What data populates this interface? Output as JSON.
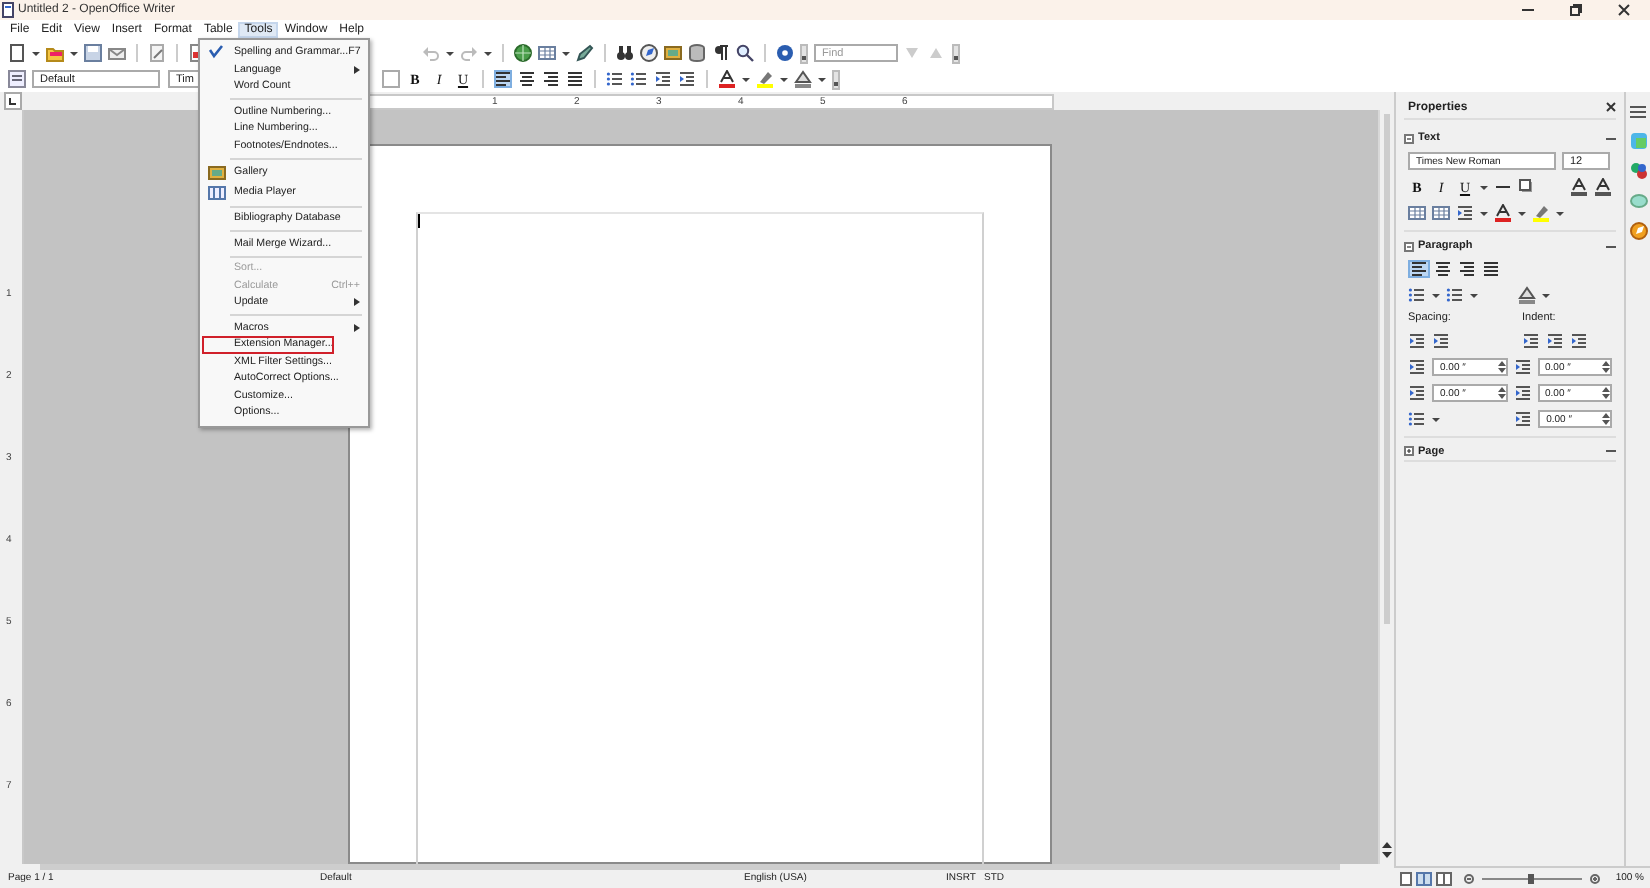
{
  "window": {
    "title": "Untitled 2 - OpenOffice Writer"
  },
  "menu_bar": [
    {
      "label": "File",
      "selected": false
    },
    {
      "label": "Edit",
      "selected": false
    },
    {
      "label": "View",
      "selected": false
    },
    {
      "label": "Insert",
      "selected": false
    },
    {
      "label": "Format",
      "selected": false
    },
    {
      "label": "Table",
      "selected": false
    },
    {
      "label": "Tools",
      "selected": true
    },
    {
      "label": "Window",
      "selected": false
    },
    {
      "label": "Help",
      "selected": false
    }
  ],
  "standard_toolbar": {
    "find_placeholder": "Find"
  },
  "formatting_toolbar": {
    "paragraph_style": "Default",
    "font_name": "Tim",
    "format_buttons": [
      "B",
      "I",
      "U"
    ],
    "alignment": [
      {
        "selected": true
      },
      {
        "selected": false
      },
      {
        "selected": false
      },
      {
        "selected": false
      }
    ]
  },
  "horizontal_ruler": [
    "1",
    "2",
    "3",
    "4",
    "5",
    "6"
  ],
  "vertical_ruler": [
    "1",
    "2",
    "3",
    "4",
    "5",
    "6",
    "7"
  ],
  "tools_menu": [
    {
      "kind": "item",
      "label": "Spelling and Grammar...",
      "shortcut": "F7",
      "has_icon": true,
      "submenu": false,
      "disabled": false,
      "outlined": false
    },
    {
      "kind": "item",
      "label": "Language",
      "has_icon": false,
      "submenu": true,
      "disabled": false,
      "outlined": false
    },
    {
      "kind": "item",
      "label": "Word Count",
      "has_icon": false,
      "submenu": false,
      "disabled": false,
      "outlined": false
    },
    {
      "kind": "separator"
    },
    {
      "kind": "item",
      "label": "Outline Numbering...",
      "has_icon": false,
      "submenu": false,
      "disabled": false,
      "outlined": false
    },
    {
      "kind": "item",
      "label": "Line Numbering...",
      "has_icon": false,
      "submenu": false,
      "disabled": false,
      "outlined": false
    },
    {
      "kind": "item",
      "label": "Footnotes/Endnotes...",
      "has_icon": false,
      "submenu": false,
      "disabled": false,
      "outlined": false
    },
    {
      "kind": "separator"
    },
    {
      "kind": "item",
      "label": "Gallery",
      "has_icon": true,
      "submenu": false,
      "disabled": false,
      "outlined": false
    },
    {
      "kind": "item",
      "label": "Media Player",
      "has_icon": true,
      "submenu": false,
      "disabled": false,
      "outlined": false
    },
    {
      "kind": "separator"
    },
    {
      "kind": "item",
      "label": "Bibliography Database",
      "has_icon": false,
      "submenu": false,
      "disabled": false,
      "outlined": false
    },
    {
      "kind": "separator"
    },
    {
      "kind": "item",
      "label": "Mail Merge Wizard...",
      "has_icon": false,
      "submenu": false,
      "disabled": false,
      "outlined": false
    },
    {
      "kind": "separator"
    },
    {
      "kind": "item",
      "label": "Sort...",
      "has_icon": false,
      "submenu": false,
      "disabled": true,
      "outlined": false
    },
    {
      "kind": "item",
      "label": "Calculate",
      "shortcut": "Ctrl++",
      "has_icon": false,
      "submenu": false,
      "disabled": true,
      "outlined": false
    },
    {
      "kind": "item",
      "label": "Update",
      "has_icon": false,
      "submenu": true,
      "disabled": false,
      "outlined": false
    },
    {
      "kind": "separator"
    },
    {
      "kind": "item",
      "label": "Macros",
      "has_icon": false,
      "submenu": true,
      "disabled": false,
      "outlined": false
    },
    {
      "kind": "item",
      "label": "Extension Manager...",
      "has_icon": false,
      "submenu": false,
      "disabled": false,
      "outlined": true
    },
    {
      "kind": "item",
      "label": "XML Filter Settings...",
      "has_icon": false,
      "submenu": false,
      "disabled": false,
      "outlined": false
    },
    {
      "kind": "item",
      "label": "AutoCorrect Options...",
      "has_icon": false,
      "submenu": false,
      "disabled": false,
      "outlined": false
    },
    {
      "kind": "item",
      "label": "Customize...",
      "has_icon": false,
      "submenu": false,
      "disabled": false,
      "outlined": false
    },
    {
      "kind": "item",
      "label": "Options...",
      "has_icon": false,
      "submenu": false,
      "disabled": false,
      "outlined": false
    }
  ],
  "sidebar": {
    "title": "Properties",
    "sections": [
      {
        "kind": "text",
        "title": "Text",
        "expanded": true,
        "font_name": "Times New Roman",
        "font_size": "12",
        "format_buttons": [
          "B",
          "I",
          "U"
        ]
      },
      {
        "kind": "paragraph",
        "title": "Paragraph",
        "expanded": true,
        "alignment": [
          {
            "selected": true
          },
          {
            "selected": false
          },
          {
            "selected": false
          },
          {
            "selected": false
          }
        ],
        "spacing_label": "Spacing:",
        "indent_label": "Indent:",
        "spacing_fields": [
          "0.00 ″",
          "0.00 ″"
        ],
        "indent_fields": [
          "0.00 ″",
          "0.00 ″",
          "0.00 ″"
        ]
      },
      {
        "kind": "page",
        "title": "Page",
        "expanded": false
      }
    ]
  },
  "status_bar": {
    "page": "Page 1 / 1",
    "page_style": "Default",
    "language": "English (USA)",
    "insert_mode": "INSRT",
    "selection_mode": "STD",
    "zoom_slider": {
      "level": 0.5
    },
    "zoom": "100 %"
  }
}
